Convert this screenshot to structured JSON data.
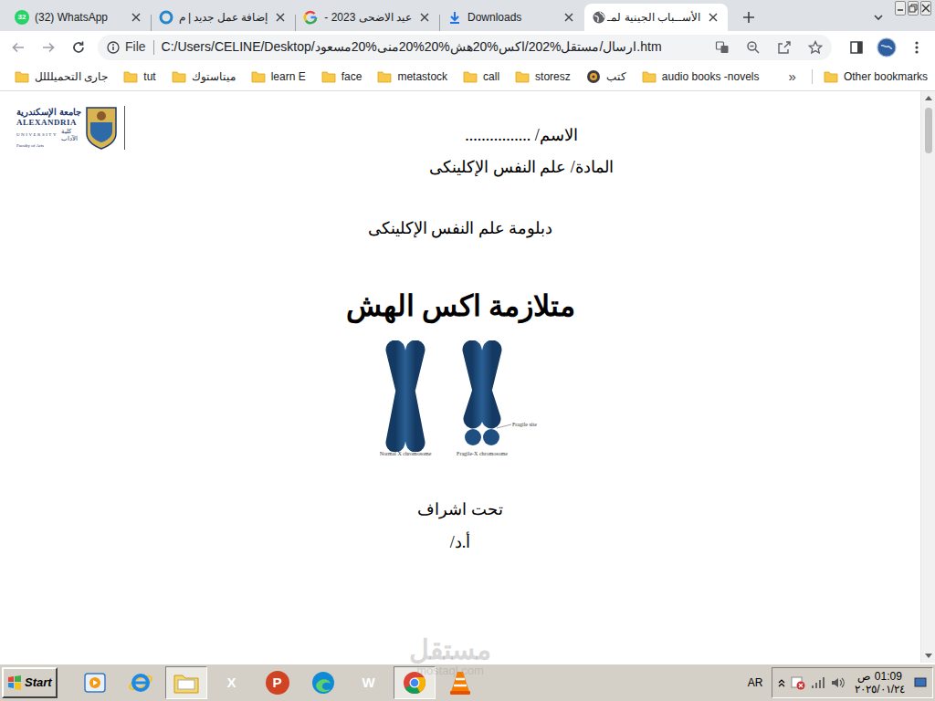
{
  "browser": {
    "tabs": [
      {
        "label": "(32) WhatsApp",
        "badge": "32",
        "kind": "whatsapp",
        "selected": false
      },
      {
        "label": "إضافة عمل جديد | م",
        "kind": "mostaql",
        "selected": false
      },
      {
        "label": "عيد الاضحى 2023 -",
        "kind": "google",
        "selected": false
      },
      {
        "label": "Downloads",
        "kind": "download",
        "selected": false
      },
      {
        "label": "الأســباب الجينية لمـ",
        "kind": "globe",
        "selected": true
      }
    ],
    "address": {
      "scheme": "File",
      "url": "C:/Users/CELINE/Desktop/ارسال/مستقل%202/اكس%20هش%20%20منى%20مسعود.htm"
    },
    "bookmarks": [
      {
        "label": "جارى التحميلللل",
        "kind": "folder"
      },
      {
        "label": "tut",
        "kind": "folder"
      },
      {
        "label": "ميتاستوك",
        "kind": "folder"
      },
      {
        "label": "learn E",
        "kind": "folder"
      },
      {
        "label": "face",
        "kind": "folder"
      },
      {
        "label": "metastock",
        "kind": "folder"
      },
      {
        "label": "call",
        "kind": "folder"
      },
      {
        "label": "storesz",
        "kind": "folder"
      },
      {
        "label": "كتب",
        "kind": "site"
      },
      {
        "label": "audio books -novels",
        "kind": "folder"
      }
    ],
    "more_bookmarks": "»",
    "other_bookmarks": "Other bookmarks"
  },
  "document": {
    "logo": {
      "arabic": "جامعة الإسكندرية",
      "english": "ALEXANDRIA",
      "university": "UNIVERSITY",
      "faculty_ar": "كلية الآداب",
      "faculty_en": "Faculty of Arts"
    },
    "name_line": "الاسم/ ................",
    "subject": "المادة/ علم النفس الإكلينكى",
    "diploma": "دبلومة علم النفس الإكلينكى",
    "title": "متلازمة اكس الهش",
    "figure": {
      "normal": "Normal X chromosome",
      "fragile": "Fragile-X chromosome",
      "site": "Fragile site"
    },
    "supervision": "تحت اشراف",
    "professor": "أ.د/"
  },
  "watermark": {
    "text": "مستقل",
    "url": "mostaql.com"
  },
  "taskbar": {
    "start": "Start",
    "apps": [
      {
        "kind": "media",
        "selected": false
      },
      {
        "kind": "ie",
        "selected": false
      },
      {
        "kind": "folder",
        "selected": true
      },
      {
        "kind": "excel",
        "glyph": "X",
        "selected": false
      },
      {
        "kind": "powerpoint",
        "glyph": "P",
        "selected": false
      },
      {
        "kind": "edge",
        "selected": false
      },
      {
        "kind": "word",
        "glyph": "W",
        "selected": false
      },
      {
        "kind": "chrome",
        "selected": true
      },
      {
        "kind": "vlc",
        "selected": false
      }
    ],
    "language": "AR",
    "time": "01:09 ص",
    "date": "٢٠٢٥/٠١/٢٤"
  }
}
